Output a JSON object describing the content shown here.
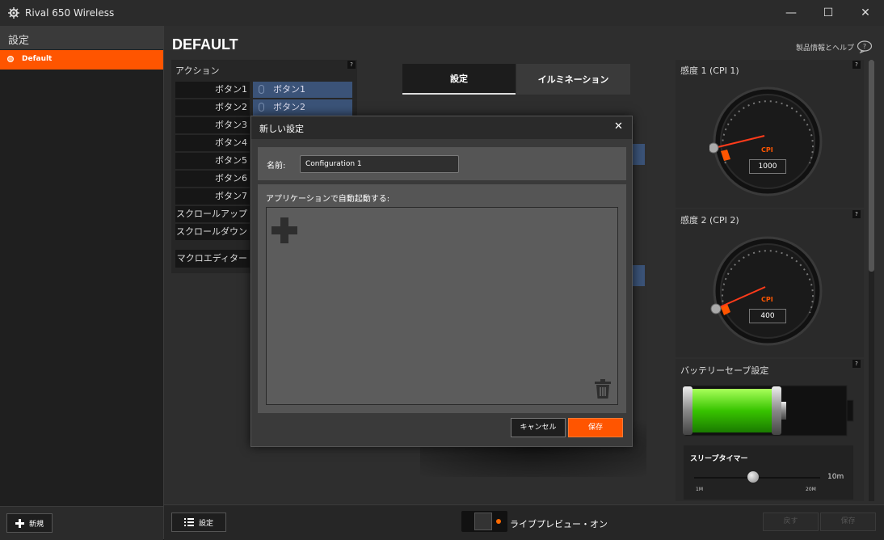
{
  "window": {
    "title": "Rival 650 Wireless",
    "minimize": "—",
    "maximize": "☐",
    "close": "✕"
  },
  "sidebar": {
    "header": "設定",
    "items": [
      {
        "label": "Default"
      }
    ],
    "new_button": "新規"
  },
  "main": {
    "title": "DEFAULT",
    "help_link": "製品情報とヘルプ"
  },
  "actions": {
    "title": "アクション",
    "help": "?",
    "rows": [
      {
        "label": "ボタン1",
        "assignment": "ボタン1"
      },
      {
        "label": "ボタン2",
        "assignment": "ボタン2"
      },
      {
        "label": "ボタン3"
      },
      {
        "label": "ボタン4"
      },
      {
        "label": "ボタン5"
      },
      {
        "label": "ボタン6"
      },
      {
        "label": "ボタン7"
      },
      {
        "label": "スクロールアップ"
      },
      {
        "label": "スクロールダウン"
      }
    ],
    "macro_editor": "マクロエディター"
  },
  "tabs": [
    {
      "label": "設定"
    },
    {
      "label": "イルミネーション"
    }
  ],
  "sensitivity1": {
    "title": "感度 1 (CPI 1)",
    "cpi_label": "CPI",
    "value": "1000",
    "help": "?"
  },
  "sensitivity2": {
    "title": "感度 2 (CPI 2)",
    "cpi_label": "CPI",
    "value": "400",
    "help": "?"
  },
  "battery": {
    "title": "バッテリーセーブ設定",
    "help": "?"
  },
  "sleep_timer": {
    "label": "スリープタイマー",
    "value": "10m",
    "min": "1M",
    "max": "20M",
    "position": 0.47
  },
  "bottom": {
    "settings_button": "設定",
    "live_preview": "ライブプレビュー・オン",
    "revert": "戻す",
    "save": "保存"
  },
  "dialog": {
    "title": "新しい設定",
    "close": "✕",
    "name_label": "名前:",
    "name_value": "Configuration 1",
    "autolaunch_label": "アプリケーションで自動起動する:",
    "cancel": "キャンセル",
    "save": "保存"
  },
  "colors": {
    "accent": "#ff5500",
    "assign_bg": "#3b5378"
  }
}
